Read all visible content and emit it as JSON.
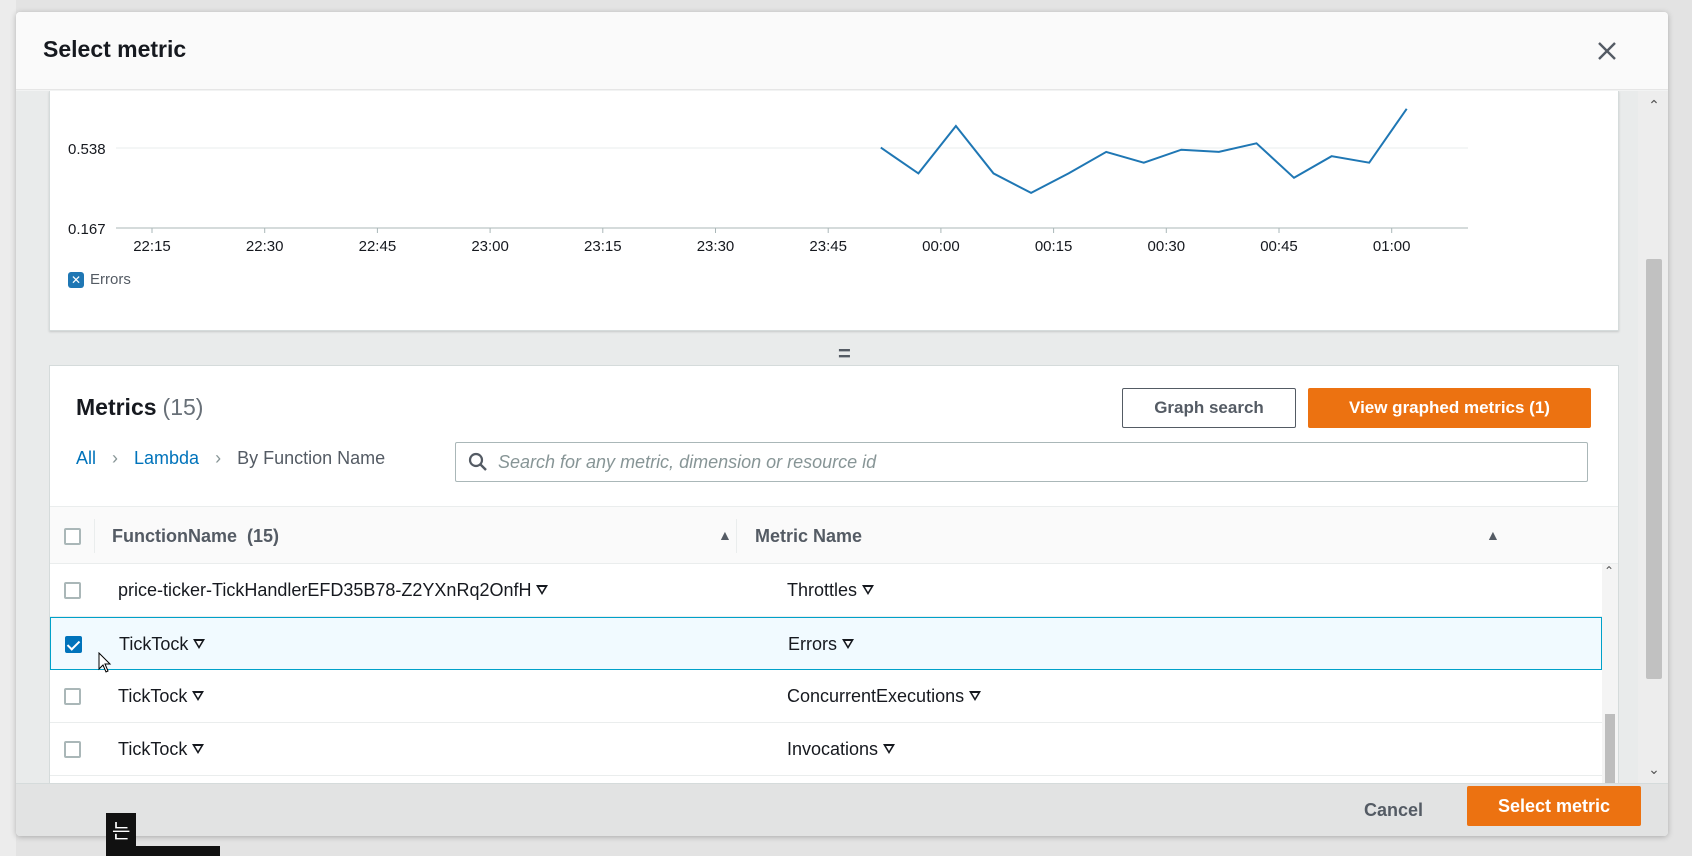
{
  "modal": {
    "title": "Select metric"
  },
  "chart": {
    "y_ticks": [
      "0.538",
      "0.167"
    ],
    "x_ticks": [
      "22:15",
      "22:30",
      "22:45",
      "23:00",
      "23:15",
      "23:30",
      "23:45",
      "00:00",
      "00:15",
      "00:30",
      "00:45",
      "01:00"
    ],
    "legend_label": "Errors",
    "line_color": "#1f77b4"
  },
  "chart_data": {
    "type": "line",
    "title": "",
    "xlabel": "",
    "ylabel": "",
    "series": [
      {
        "name": "Errors",
        "x": [
          "23:52",
          "23:57",
          "00:02",
          "00:07",
          "00:12",
          "00:17",
          "00:22",
          "00:27",
          "00:32",
          "00:37",
          "00:42",
          "00:47",
          "00:52",
          "00:57",
          "01:02"
        ],
        "values": [
          0.54,
          0.42,
          0.64,
          0.42,
          0.33,
          0.42,
          0.52,
          0.47,
          0.53,
          0.52,
          0.56,
          0.4,
          0.5,
          0.47,
          0.72
        ]
      }
    ],
    "ylim": [
      0.167,
      0.72
    ],
    "y_axis_ticks": [
      0.167,
      0.538
    ],
    "grid": true,
    "legend": "bottom-left"
  },
  "metrics": {
    "title": "Metrics",
    "count": "(15)",
    "graph_search_label": "Graph search",
    "view_graphed_label": "View graphed metrics (1)",
    "breadcrumb": {
      "all": "All",
      "namespace": "Lambda",
      "dimension": "By Function Name"
    },
    "search": {
      "placeholder": "Search for any metric, dimension or resource id",
      "value": ""
    },
    "columns": {
      "function_name": "FunctionName",
      "function_name_count": "(15)",
      "metric_name": "Metric Name"
    },
    "rows": [
      {
        "function": "price-ticker-TickHandlerEFD35B78-Z2YXnRq2OnfH",
        "metric": "Throttles",
        "checked": false
      },
      {
        "function": "TickTock",
        "metric": "Errors",
        "checked": true
      },
      {
        "function": "TickTock",
        "metric": "ConcurrentExecutions",
        "checked": false
      },
      {
        "function": "TickTock",
        "metric": "Invocations",
        "checked": false
      }
    ]
  },
  "footer": {
    "cancel_label": "Cancel",
    "select_label": "Select metric"
  },
  "overlay": {
    "caption": "는"
  },
  "colors": {
    "accent": "#ec7211",
    "link": "#0073bb",
    "selected_row": "#f1faff",
    "selected_border": "#00a1c9"
  }
}
